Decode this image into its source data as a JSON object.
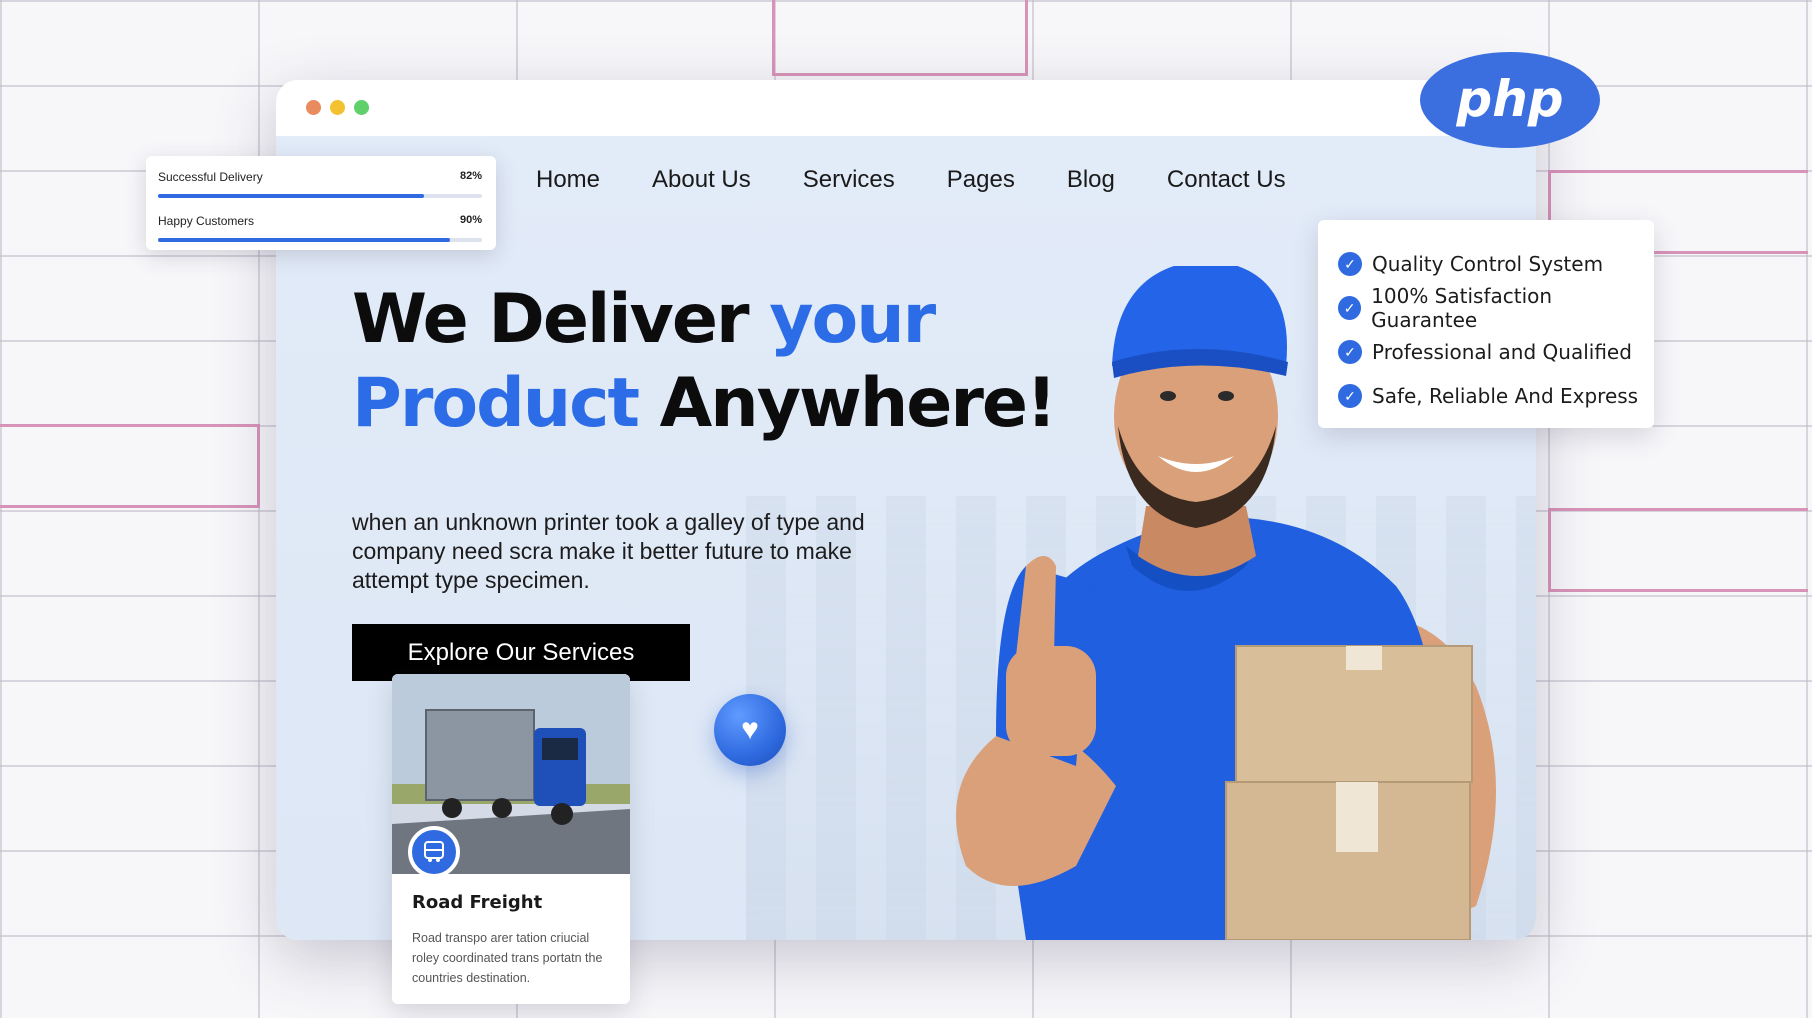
{
  "colors": {
    "accent": "#2c6ce6",
    "cta_background": "#000000",
    "window_dot_red": "#e98a5f",
    "window_dot_yellow": "#f4c230",
    "window_dot_green": "#5fd06a",
    "php_logo": "#3b6fe0"
  },
  "logo": {
    "text": "php"
  },
  "nav": {
    "items": [
      {
        "label": "Home"
      },
      {
        "label": "About Us"
      },
      {
        "label": "Services"
      },
      {
        "label": "Pages"
      },
      {
        "label": "Blog"
      },
      {
        "label": "Contact Us"
      }
    ]
  },
  "stats": [
    {
      "label": "Successful Delivery",
      "value_text": "82%",
      "value": 0.82
    },
    {
      "label": "Happy Customers",
      "value_text": "90%",
      "value": 0.9
    }
  ],
  "hero": {
    "title_part1": "We Deliver ",
    "title_part2": "your",
    "title_part3": "Product",
    "title_part4": " Anywhere!",
    "description": "when an unknown printer took a galley of type and company need scra make it better future to make attempt type specimen.",
    "cta_label": "Explore Our Services"
  },
  "features": [
    {
      "label": "Quality Control System",
      "icon": "check-circle-icon"
    },
    {
      "label": "100% Satisfaction Guarantee",
      "icon": "check-circle-icon"
    },
    {
      "label": "Professional and Qualified",
      "icon": "check-circle-icon"
    },
    {
      "label": "Safe, Reliable And Express",
      "icon": "check-circle-icon"
    }
  ],
  "service_card": {
    "title": "Road Freight",
    "description": "Road transpo arer tation criucial roley coordinated trans portatn the countries destination.",
    "icon": "truck-icon"
  },
  "decor": {
    "heart_icon": "heart-icon"
  }
}
